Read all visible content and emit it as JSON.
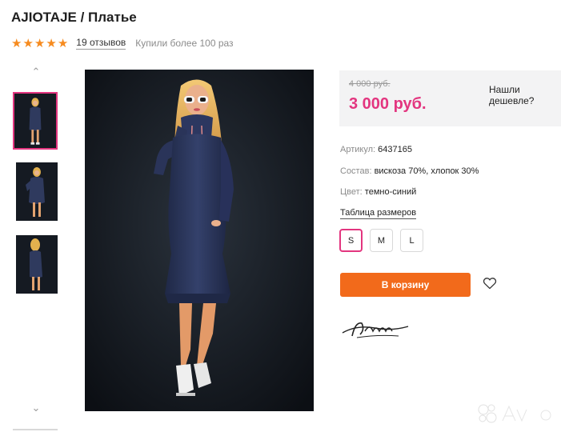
{
  "product": {
    "title": "AJIOTAJE / Платье",
    "rating_stars": 5,
    "reviews": "19 отзывов",
    "bought": "Купили более 100 раз"
  },
  "gallery": {
    "up_arrow": "⌃",
    "down_arrow": "⌄",
    "thumbnail_count": 3,
    "selected_index": 0
  },
  "pricing": {
    "old_price": "4 000 руб.",
    "new_price": "3 000 руб.",
    "cheaper_link": "Нашли дешевле?"
  },
  "attributes": {
    "article_label": "Артикул:",
    "article_value": "6437165",
    "composition_label": "Состав:",
    "composition_value": "вискоза 70%, хлопок 30%",
    "color_label": "Цвет:",
    "color_value": "темно-синий"
  },
  "size_table_link": "Таблица размеров",
  "sizes": [
    "S",
    "M",
    "L"
  ],
  "selected_size": "S",
  "cart_button": "В корзину",
  "colors": {
    "accent_pink": "#e3357f",
    "button_orange": "#f26a1b",
    "star_orange": "#f68b1f",
    "dress_navy": "#2b3556"
  }
}
